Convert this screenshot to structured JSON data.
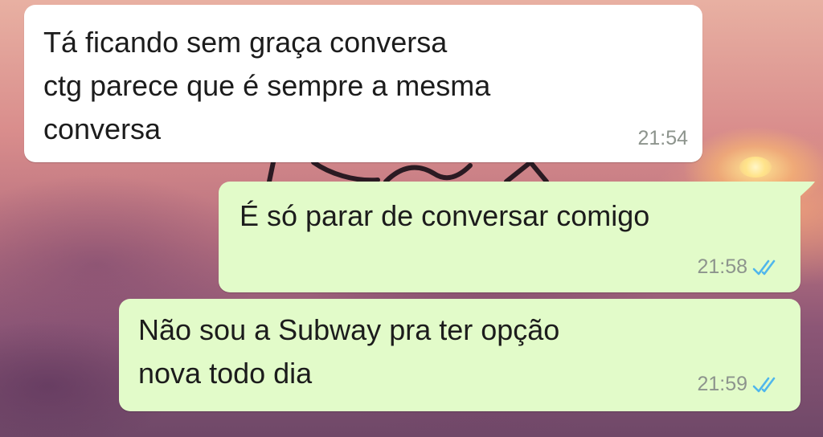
{
  "chat": {
    "messages": [
      {
        "direction": "incoming",
        "text": "Tá ficando sem graça conversa\nctg parece que é sempre a mesma\nconversa",
        "time": "21:54"
      },
      {
        "direction": "outgoing",
        "text": "É só parar de conversar comigo",
        "time": "21:58",
        "status_icon": "double-check-icon"
      },
      {
        "direction": "outgoing",
        "text": "Não sou a Subway pra ter opção\nnova todo dia",
        "time": "21:59",
        "status_icon": "double-check-icon"
      }
    ]
  },
  "colors": {
    "incoming_bubble": "#ffffff",
    "outgoing_bubble": "#e2fbc9",
    "read_tick": "#4fb6ec",
    "timestamp": "#8d948d"
  }
}
